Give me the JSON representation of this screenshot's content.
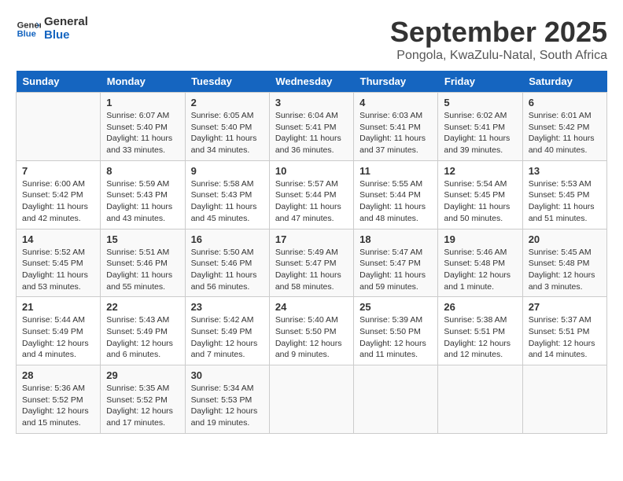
{
  "header": {
    "logo_line1": "General",
    "logo_line2": "Blue",
    "month": "September 2025",
    "location": "Pongola, KwaZulu-Natal, South Africa"
  },
  "columns": [
    "Sunday",
    "Monday",
    "Tuesday",
    "Wednesday",
    "Thursday",
    "Friday",
    "Saturday"
  ],
  "weeks": [
    [
      {
        "day": "",
        "info": ""
      },
      {
        "day": "1",
        "info": "Sunrise: 6:07 AM\nSunset: 5:40 PM\nDaylight: 11 hours\nand 33 minutes."
      },
      {
        "day": "2",
        "info": "Sunrise: 6:05 AM\nSunset: 5:40 PM\nDaylight: 11 hours\nand 34 minutes."
      },
      {
        "day": "3",
        "info": "Sunrise: 6:04 AM\nSunset: 5:41 PM\nDaylight: 11 hours\nand 36 minutes."
      },
      {
        "day": "4",
        "info": "Sunrise: 6:03 AM\nSunset: 5:41 PM\nDaylight: 11 hours\nand 37 minutes."
      },
      {
        "day": "5",
        "info": "Sunrise: 6:02 AM\nSunset: 5:41 PM\nDaylight: 11 hours\nand 39 minutes."
      },
      {
        "day": "6",
        "info": "Sunrise: 6:01 AM\nSunset: 5:42 PM\nDaylight: 11 hours\nand 40 minutes."
      }
    ],
    [
      {
        "day": "7",
        "info": "Sunrise: 6:00 AM\nSunset: 5:42 PM\nDaylight: 11 hours\nand 42 minutes."
      },
      {
        "day": "8",
        "info": "Sunrise: 5:59 AM\nSunset: 5:43 PM\nDaylight: 11 hours\nand 43 minutes."
      },
      {
        "day": "9",
        "info": "Sunrise: 5:58 AM\nSunset: 5:43 PM\nDaylight: 11 hours\nand 45 minutes."
      },
      {
        "day": "10",
        "info": "Sunrise: 5:57 AM\nSunset: 5:44 PM\nDaylight: 11 hours\nand 47 minutes."
      },
      {
        "day": "11",
        "info": "Sunrise: 5:55 AM\nSunset: 5:44 PM\nDaylight: 11 hours\nand 48 minutes."
      },
      {
        "day": "12",
        "info": "Sunrise: 5:54 AM\nSunset: 5:45 PM\nDaylight: 11 hours\nand 50 minutes."
      },
      {
        "day": "13",
        "info": "Sunrise: 5:53 AM\nSunset: 5:45 PM\nDaylight: 11 hours\nand 51 minutes."
      }
    ],
    [
      {
        "day": "14",
        "info": "Sunrise: 5:52 AM\nSunset: 5:45 PM\nDaylight: 11 hours\nand 53 minutes."
      },
      {
        "day": "15",
        "info": "Sunrise: 5:51 AM\nSunset: 5:46 PM\nDaylight: 11 hours\nand 55 minutes."
      },
      {
        "day": "16",
        "info": "Sunrise: 5:50 AM\nSunset: 5:46 PM\nDaylight: 11 hours\nand 56 minutes."
      },
      {
        "day": "17",
        "info": "Sunrise: 5:49 AM\nSunset: 5:47 PM\nDaylight: 11 hours\nand 58 minutes."
      },
      {
        "day": "18",
        "info": "Sunrise: 5:47 AM\nSunset: 5:47 PM\nDaylight: 11 hours\nand 59 minutes."
      },
      {
        "day": "19",
        "info": "Sunrise: 5:46 AM\nSunset: 5:48 PM\nDaylight: 12 hours\nand 1 minute."
      },
      {
        "day": "20",
        "info": "Sunrise: 5:45 AM\nSunset: 5:48 PM\nDaylight: 12 hours\nand 3 minutes."
      }
    ],
    [
      {
        "day": "21",
        "info": "Sunrise: 5:44 AM\nSunset: 5:49 PM\nDaylight: 12 hours\nand 4 minutes."
      },
      {
        "day": "22",
        "info": "Sunrise: 5:43 AM\nSunset: 5:49 PM\nDaylight: 12 hours\nand 6 minutes."
      },
      {
        "day": "23",
        "info": "Sunrise: 5:42 AM\nSunset: 5:49 PM\nDaylight: 12 hours\nand 7 minutes."
      },
      {
        "day": "24",
        "info": "Sunrise: 5:40 AM\nSunset: 5:50 PM\nDaylight: 12 hours\nand 9 minutes."
      },
      {
        "day": "25",
        "info": "Sunrise: 5:39 AM\nSunset: 5:50 PM\nDaylight: 12 hours\nand 11 minutes."
      },
      {
        "day": "26",
        "info": "Sunrise: 5:38 AM\nSunset: 5:51 PM\nDaylight: 12 hours\nand 12 minutes."
      },
      {
        "day": "27",
        "info": "Sunrise: 5:37 AM\nSunset: 5:51 PM\nDaylight: 12 hours\nand 14 minutes."
      }
    ],
    [
      {
        "day": "28",
        "info": "Sunrise: 5:36 AM\nSunset: 5:52 PM\nDaylight: 12 hours\nand 15 minutes."
      },
      {
        "day": "29",
        "info": "Sunrise: 5:35 AM\nSunset: 5:52 PM\nDaylight: 12 hours\nand 17 minutes."
      },
      {
        "day": "30",
        "info": "Sunrise: 5:34 AM\nSunset: 5:53 PM\nDaylight: 12 hours\nand 19 minutes."
      },
      {
        "day": "",
        "info": ""
      },
      {
        "day": "",
        "info": ""
      },
      {
        "day": "",
        "info": ""
      },
      {
        "day": "",
        "info": ""
      }
    ]
  ]
}
